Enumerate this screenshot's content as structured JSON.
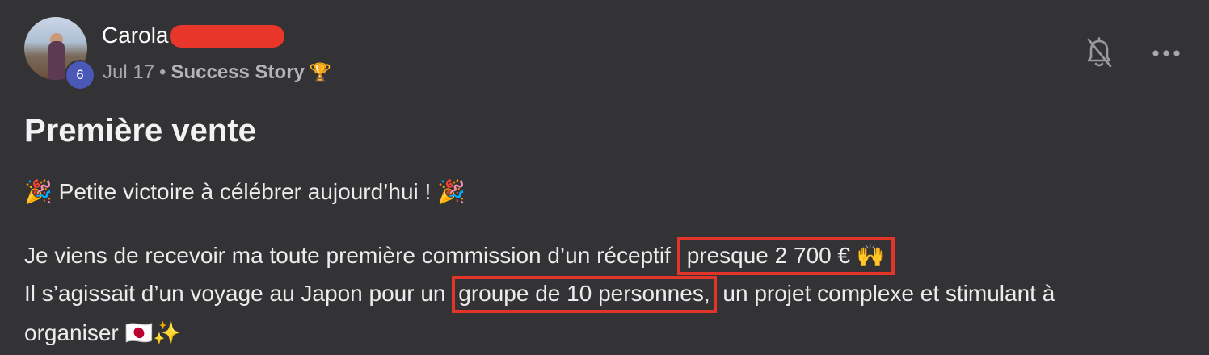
{
  "author": {
    "name": "Carola",
    "level": "6"
  },
  "meta": {
    "date": "Jul 17",
    "separator": "•",
    "category": "Success Story",
    "category_emoji": "🏆"
  },
  "post": {
    "title": "Première vente",
    "line1": "🎉 Petite victoire à célébrer aujourd’hui ! 🎉",
    "line2_before": "Je viens de recevoir ma toute première commission d’un réceptif ",
    "line2_highlight": "presque 2 700 € 🙌",
    "line3_before": "Il s’agissait d’un voyage au Japon pour un ",
    "line3_highlight": "groupe de 10 personnes,",
    "line3_after": " un projet complexe et stimulant à",
    "line4": "organiser 🇯🇵✨"
  },
  "colors": {
    "background": "#333335",
    "highlight": "#e3342a",
    "level_badge": "#4a58b8"
  },
  "icons": {
    "notifications": "bell-off-icon",
    "options": "more-horizontal-icon"
  }
}
